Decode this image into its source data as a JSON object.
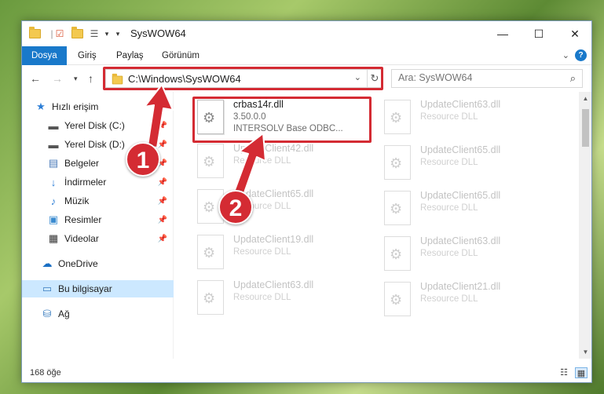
{
  "window": {
    "title": "SysWOW64",
    "minimize_glyph": "—",
    "maximize_glyph": "☐",
    "close_glyph": "✕"
  },
  "ribbon": {
    "tabs": [
      {
        "label": "Dosya",
        "active": true
      },
      {
        "label": "Giriş"
      },
      {
        "label": "Paylaş"
      },
      {
        "label": "Görünüm"
      }
    ]
  },
  "address": {
    "path": "C:\\Windows\\SysWOW64"
  },
  "search": {
    "placeholder": "Ara: SysWOW64"
  },
  "sidebar": {
    "items": [
      {
        "label": "Hızlı erişim",
        "icon": "star-icon"
      },
      {
        "label": "Yerel Disk (C:)",
        "icon": "drive-icon",
        "pinned": true
      },
      {
        "label": "Yerel Disk (D:)",
        "icon": "drive-icon",
        "pinned": true
      },
      {
        "label": "Belgeler",
        "icon": "documents-icon",
        "pinned": true
      },
      {
        "label": "İndirmeler",
        "icon": "downloads-icon",
        "pinned": true
      },
      {
        "label": "Müzik",
        "icon": "music-icon",
        "pinned": true
      },
      {
        "label": "Resimler",
        "icon": "pictures-icon",
        "pinned": true
      },
      {
        "label": "Videolar",
        "icon": "videos-icon",
        "pinned": true
      },
      {
        "label": "OneDrive",
        "icon": "cloud-icon"
      },
      {
        "label": "Bu bilgisayar",
        "icon": "computer-icon",
        "selected": true
      },
      {
        "label": "Ağ",
        "icon": "network-icon"
      }
    ]
  },
  "files": {
    "highlighted": {
      "name": "crbas14r.dll",
      "version": "3.50.0.0",
      "description": "INTERSOLV Base ODBC..."
    },
    "left_column": [
      {
        "name": "UpdateClient42.dll",
        "type": "Resource DLL"
      },
      {
        "name": "UpdateClient65.dll",
        "type": "Resource DLL"
      },
      {
        "name": "UpdateClient19.dll",
        "type": "Resource DLL"
      },
      {
        "name": "UpdateClient63.dll",
        "type": "Resource DLL"
      }
    ],
    "right_column": [
      {
        "name": "UpdateClient63.dll",
        "type": "Resource DLL"
      },
      {
        "name": "UpdateClient65.dll",
        "type": "Resource DLL"
      },
      {
        "name": "UpdateClient65.dll",
        "type": "Resource DLL"
      },
      {
        "name": "UpdateClient63.dll",
        "type": "Resource DLL"
      },
      {
        "name": "UpdateClient21.dll",
        "type": "Resource DLL"
      }
    ]
  },
  "status": {
    "count": "168 öğe"
  },
  "callouts": [
    "1",
    "2"
  ],
  "colors": {
    "accent": "#1979ca",
    "highlight": "#d42b33",
    "selection": "#cce8ff"
  }
}
